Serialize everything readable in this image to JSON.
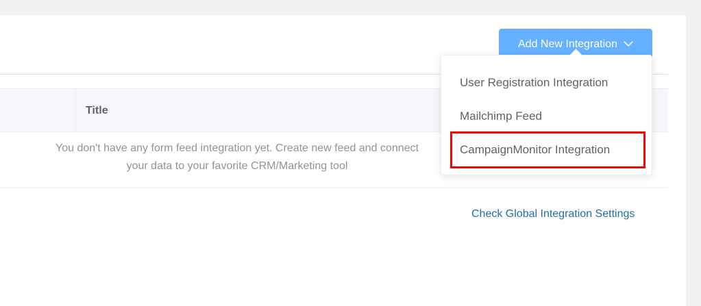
{
  "actions": {
    "add_button_label": "Add New Integration",
    "add_button_color": "#66b1ff"
  },
  "table": {
    "columns": [
      "",
      "Title"
    ],
    "empty_text_line1": "You don't have any form feed integration yet. Create new feed and connect",
    "empty_text_line2": "your data to your favorite CRM/Marketing tool"
  },
  "dropdown": {
    "items": [
      {
        "label": "User Registration Integration"
      },
      {
        "label": "Mailchimp Feed"
      },
      {
        "label": "CampaignMonitor Integration",
        "highlighted": true
      }
    ],
    "highlight_color": "#ff0000"
  },
  "footer": {
    "global_settings_link": "Check Global Integration Settings",
    "link_color": "#1f6fa6"
  },
  "icons": {
    "button_icon": "chevron-down-icon"
  }
}
